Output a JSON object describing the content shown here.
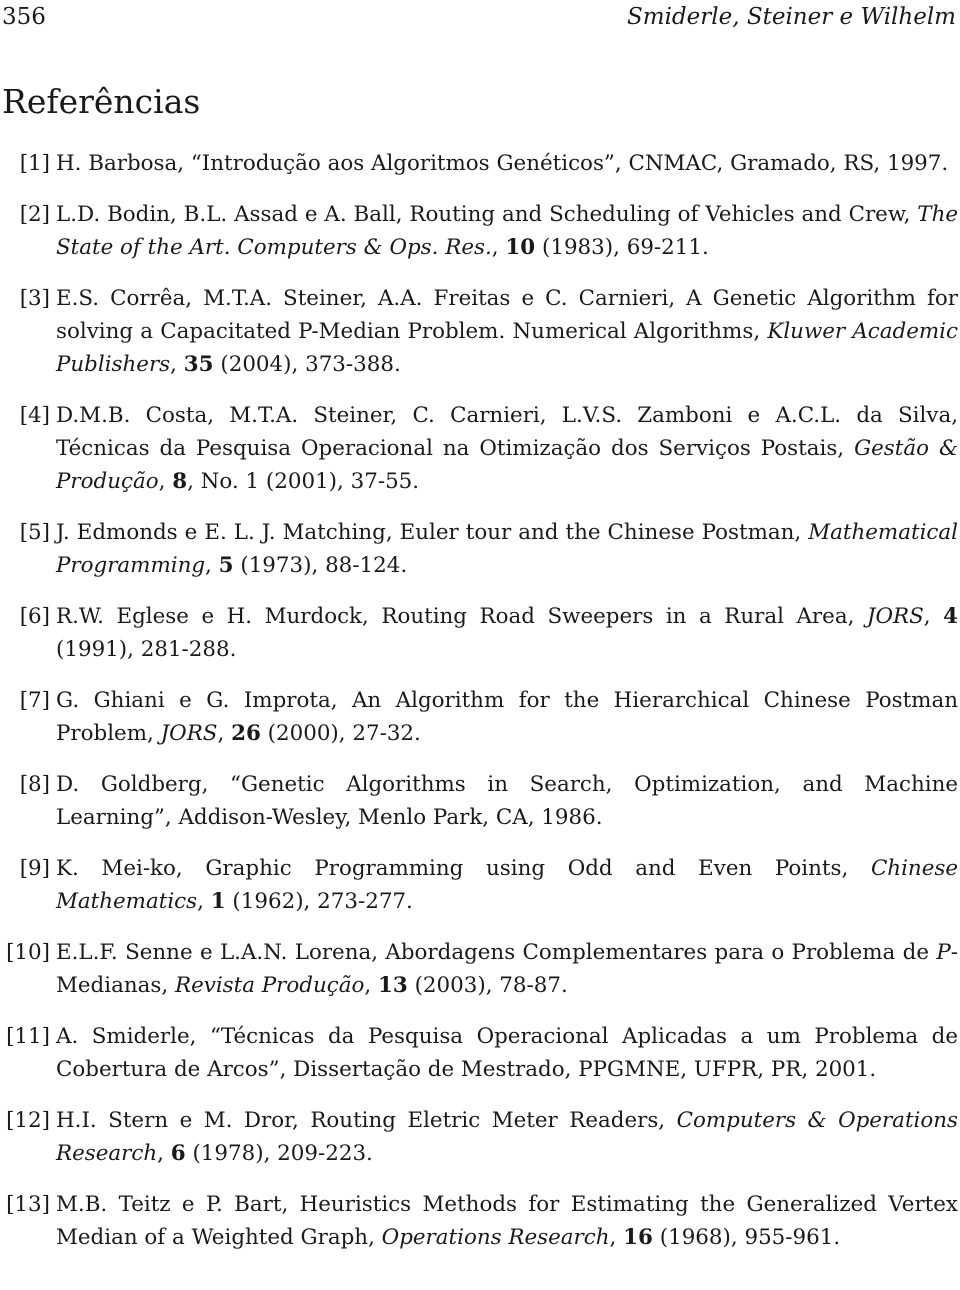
{
  "header": {
    "page_number": "356",
    "running_title": "Smiderle, Steiner e Wilhelm"
  },
  "section": {
    "title": "Referências"
  },
  "references": [
    {
      "label": "[1]",
      "segments": [
        {
          "style": "normal",
          "text": "H. Barbosa, “Introdução aos Algoritmos Genéticos”, CNMAC, Gramado, RS, 1997."
        }
      ]
    },
    {
      "label": "[2]",
      "segments": [
        {
          "style": "normal",
          "text": "L.D. Bodin, B.L. Assad e A. Ball, Routing and Scheduling of Vehicles and Crew, "
        },
        {
          "style": "italic",
          "text": "The State of the Art. Computers & Ops. Res."
        },
        {
          "style": "normal",
          "text": ", "
        },
        {
          "style": "bold",
          "text": "10"
        },
        {
          "style": "normal",
          "text": " (1983), 69-211."
        }
      ]
    },
    {
      "label": "[3]",
      "segments": [
        {
          "style": "normal",
          "text": "E.S. Corrêa, M.T.A. Steiner, A.A. Freitas e C. Carnieri, A Genetic Algorithm for solving a Capacitated P-Median Problem. Numerical Algorithms, "
        },
        {
          "style": "italic",
          "text": "Kluwer Academic Publishers"
        },
        {
          "style": "normal",
          "text": ", "
        },
        {
          "style": "bold",
          "text": "35"
        },
        {
          "style": "normal",
          "text": " (2004), 373-388."
        }
      ]
    },
    {
      "label": "[4]",
      "segments": [
        {
          "style": "normal",
          "text": "D.M.B. Costa, M.T.A. Steiner, C. Carnieri, L.V.S. Zamboni e A.C.L. da Silva, Técnicas da Pesquisa Operacional na Otimização dos Serviços Postais, "
        },
        {
          "style": "italic",
          "text": "Gestão & Produção"
        },
        {
          "style": "normal",
          "text": ", "
        },
        {
          "style": "bold",
          "text": "8"
        },
        {
          "style": "normal",
          "text": ", No. 1 (2001), 37-55."
        }
      ]
    },
    {
      "label": "[5]",
      "segments": [
        {
          "style": "normal",
          "text": "J. Edmonds e E. L. J. Matching, Euler tour and the Chinese Postman, "
        },
        {
          "style": "italic",
          "text": "Mathematical Programming"
        },
        {
          "style": "normal",
          "text": ", "
        },
        {
          "style": "bold",
          "text": "5"
        },
        {
          "style": "normal",
          "text": " (1973), 88-124."
        }
      ]
    },
    {
      "label": "[6]",
      "segments": [
        {
          "style": "normal",
          "text": "R.W. Eglese e H. Murdock, Routing Road Sweepers in a Rural Area, "
        },
        {
          "style": "italic",
          "text": "JORS"
        },
        {
          "style": "normal",
          "text": ", "
        },
        {
          "style": "bold",
          "text": "4"
        },
        {
          "style": "normal",
          "text": " (1991), 281-288."
        }
      ]
    },
    {
      "label": "[7]",
      "segments": [
        {
          "style": "normal",
          "text": "G. Ghiani e G. Improta, An Algorithm for the Hierarchical Chinese Postman Problem, "
        },
        {
          "style": "italic",
          "text": "JORS"
        },
        {
          "style": "normal",
          "text": ", "
        },
        {
          "style": "bold",
          "text": "26"
        },
        {
          "style": "normal",
          "text": " (2000), 27-32."
        }
      ]
    },
    {
      "label": "[8]",
      "segments": [
        {
          "style": "normal",
          "text": "D. Goldberg, “Genetic Algorithms in Search, Optimization, and Machine Learning”, Addison-Wesley, Menlo Park, CA, 1986."
        }
      ]
    },
    {
      "label": "[9]",
      "segments": [
        {
          "style": "normal",
          "text": "K. Mei-ko, Graphic Programming using Odd and Even Points, "
        },
        {
          "style": "italic",
          "text": "Chinese Mathematics"
        },
        {
          "style": "normal",
          "text": ", "
        },
        {
          "style": "bold",
          "text": "1"
        },
        {
          "style": "normal",
          "text": " (1962), 273-277."
        }
      ]
    },
    {
      "label": "[10]",
      "segments": [
        {
          "style": "normal",
          "text": "E.L.F. Senne e L.A.N. Lorena, Abordagens Complementares para o Problema de "
        },
        {
          "style": "italic",
          "text": "P"
        },
        {
          "style": "normal",
          "text": "-Medianas, "
        },
        {
          "style": "italic",
          "text": "Revista Produção"
        },
        {
          "style": "normal",
          "text": ", "
        },
        {
          "style": "bold",
          "text": "13"
        },
        {
          "style": "normal",
          "text": " (2003), 78-87."
        }
      ]
    },
    {
      "label": "[11]",
      "segments": [
        {
          "style": "normal",
          "text": "A. Smiderle, “Técnicas da Pesquisa Operacional Aplicadas a um Problema de Cobertura de Arcos”, Dissertação de Mestrado, PPGMNE, UFPR, PR, 2001."
        }
      ]
    },
    {
      "label": "[12]",
      "segments": [
        {
          "style": "normal",
          "text": "H.I. Stern e M. Dror, Routing Eletric Meter Readers, "
        },
        {
          "style": "italic",
          "text": "Computers & Operations Research"
        },
        {
          "style": "normal",
          "text": ", "
        },
        {
          "style": "bold",
          "text": "6"
        },
        {
          "style": "normal",
          "text": " (1978), 209-223."
        }
      ]
    },
    {
      "label": "[13]",
      "segments": [
        {
          "style": "normal",
          "text": "M.B. Teitz e P. Bart, Heuristics Methods for Estimating the Generalized Vertex Median of a Weighted Graph, "
        },
        {
          "style": "italic",
          "text": "Operations Research"
        },
        {
          "style": "normal",
          "text": ", "
        },
        {
          "style": "bold",
          "text": "16"
        },
        {
          "style": "normal",
          "text": " (1968), 955-961."
        }
      ]
    }
  ]
}
